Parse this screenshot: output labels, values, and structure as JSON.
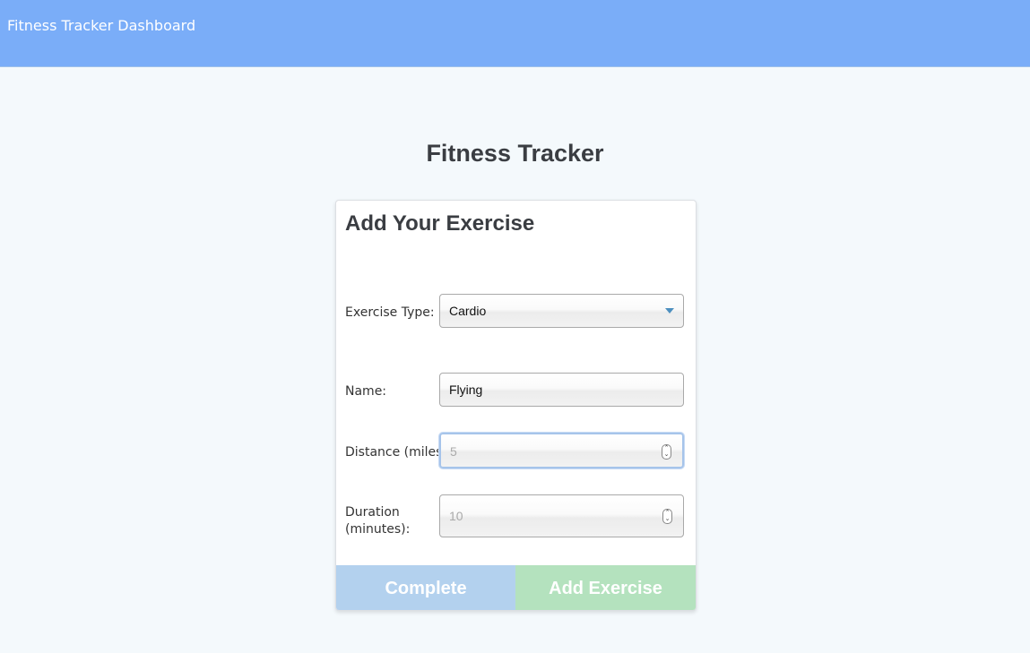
{
  "header": {
    "brand": "Fitness Tracker Dashboard"
  },
  "page": {
    "title": "Fitness Tracker"
  },
  "form": {
    "heading": "Add Your Exercise",
    "exercise_type": {
      "label": "Exercise Type:",
      "value": "Cardio"
    },
    "name": {
      "label": "Name:",
      "value": "Flying"
    },
    "distance": {
      "label": "Distance (miles):",
      "value": "5"
    },
    "duration": {
      "label_line1": "Duration",
      "label_line2": "(minutes):",
      "value": "10"
    },
    "buttons": {
      "complete": "Complete",
      "add": "Add Exercise"
    }
  },
  "colors": {
    "header_bg": "#7aadf8",
    "complete_btn": "#b3d1ee",
    "add_btn": "#b4e2be"
  }
}
